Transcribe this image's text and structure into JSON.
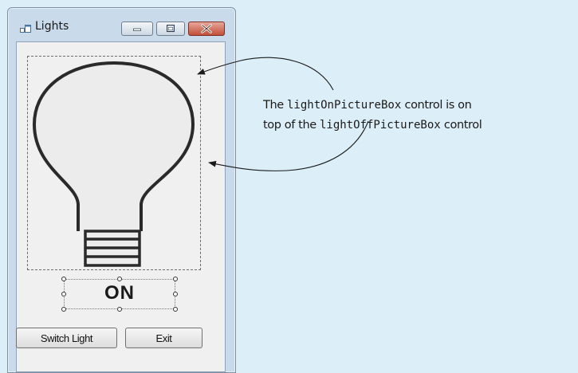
{
  "window": {
    "title": "Lights",
    "icon": "form-icon"
  },
  "label": {
    "text": "ON"
  },
  "buttons": {
    "switch_label": "Switch Light",
    "exit_label": "Exit"
  },
  "annotation": {
    "line1_pre": "The ",
    "line1_code": "lightOnPictureBox",
    "line1_post": " control is on",
    "line2_pre": "top of the ",
    "line2_code": "lightOffPictureBox",
    "line2_post": " control"
  }
}
